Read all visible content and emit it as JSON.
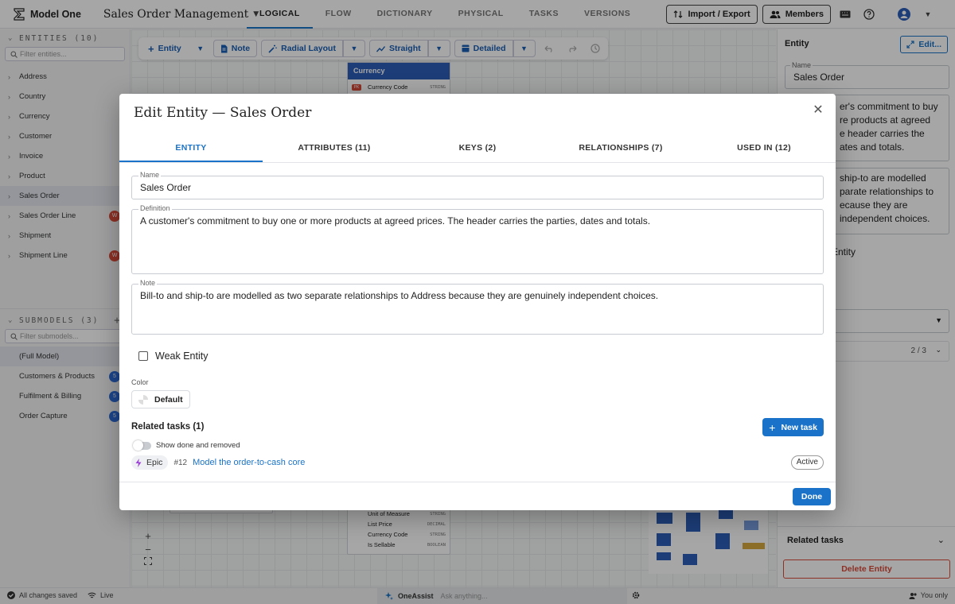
{
  "app": {
    "name": "Model One",
    "model_title": "Sales Order Management"
  },
  "nav_tabs": [
    "LOGICAL",
    "FLOW",
    "DICTIONARY",
    "PHYSICAL",
    "TASKS",
    "VERSIONS"
  ],
  "header_actions": {
    "import_export": "Import / Export",
    "members": "Members"
  },
  "sidebar": {
    "entities_header": "ENTITIES (10)",
    "entity_filter_placeholder": "Filter entities...",
    "entities": [
      {
        "label": "Address"
      },
      {
        "label": "Country"
      },
      {
        "label": "Currency"
      },
      {
        "label": "Customer"
      },
      {
        "label": "Invoice"
      },
      {
        "label": "Product"
      },
      {
        "label": "Sales Order"
      },
      {
        "label": "Sales Order Line",
        "badge": "W"
      },
      {
        "label": "Shipment"
      },
      {
        "label": "Shipment Line",
        "badge": "W"
      }
    ],
    "submodels_header": "SUBMODELS (3)",
    "submodel_filter_placeholder": "Filter submodels...",
    "submodels": [
      {
        "label": "(Full Model)"
      },
      {
        "label": "Customers & Products",
        "badge": "5"
      },
      {
        "label": "Fulfilment & Billing",
        "badge": "5"
      },
      {
        "label": "Order Capture",
        "badge": "5"
      }
    ]
  },
  "toolbar": {
    "entity": "Entity",
    "note": "Note",
    "layout": "Radial Layout",
    "line_style": "Straight",
    "detail": "Detailed"
  },
  "canvas": {
    "currency_node": {
      "title": "Currency",
      "rows": [
        {
          "key": "PK",
          "name": "Currency Code",
          "type": "STRING"
        }
      ]
    },
    "product_node_rows": [
      {
        "name": "Unit of Measure",
        "type": "STRING"
      },
      {
        "name": "List Price",
        "type": "DECIMAL"
      },
      {
        "name": "Currency Code",
        "type": "STRING"
      },
      {
        "name": "Is Sellable",
        "type": "BOOLEAN"
      }
    ]
  },
  "right_panel": {
    "title": "Entity",
    "edit_label": "Edit...",
    "name_label": "Name",
    "name_value": "Sales Order",
    "definition_fragments": [
      "er's commitment to buy",
      "re products at agreed",
      "e header carries the",
      "ates and totals."
    ],
    "note_fragments": [
      "ship-to are modelled",
      "parate relationships to",
      "ecause they are",
      "independent choices."
    ],
    "weak_fragment": "Entity",
    "submodel_counter": "2 / 3",
    "related_tasks": "Related tasks",
    "delete_label": "Delete Entity"
  },
  "status_bar": {
    "saved": "All changes saved",
    "live": "Live",
    "assist_name": "OneAssist",
    "assist_placeholder": "Ask anything...",
    "visibility": "You only"
  },
  "modal": {
    "title": "Edit Entity — Sales Order",
    "tabs": [
      "ENTITY",
      "ATTRIBUTES (11)",
      "KEYS (2)",
      "RELATIONSHIPS (7)",
      "USED IN (12)"
    ],
    "name_label": "Name",
    "name_value": "Sales Order",
    "definition_label": "Definition",
    "definition_value": "A customer's commitment to buy one or more products at agreed prices. The header carries the parties, dates and totals.",
    "note_label": "Note",
    "note_value": "Bill-to and ship-to are modelled as two separate relationships to Address because they are genuinely independent choices.",
    "weak_entity_label": "Weak Entity",
    "color_label": "Color",
    "color_value": "Default",
    "related_tasks_title": "Related tasks (1)",
    "new_task_label": "New task",
    "show_done_label": "Show done and removed",
    "task": {
      "type": "Epic",
      "number": "#12",
      "title": "Model the order-to-cash core",
      "status": "Active"
    },
    "done_label": "Done"
  },
  "colors": {
    "accent": "#1a73c8",
    "node_header": "#2d5fb9",
    "warning": "#d94a3a"
  }
}
